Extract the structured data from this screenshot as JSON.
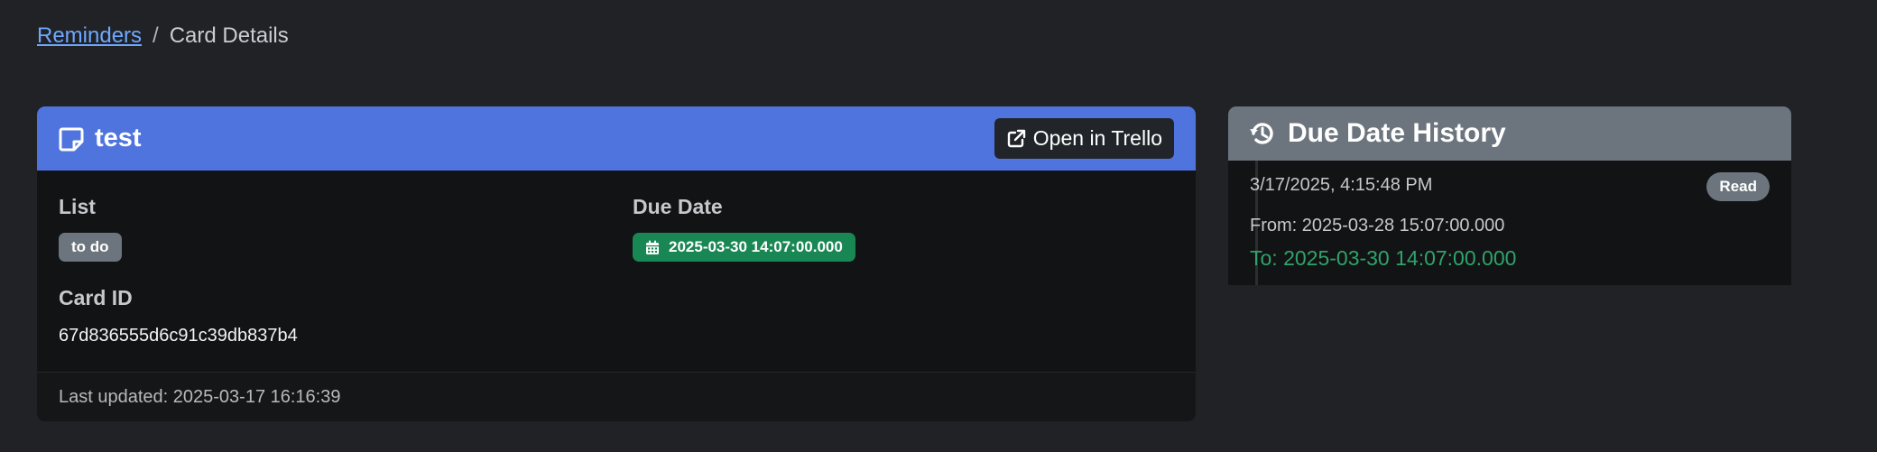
{
  "breadcrumb": {
    "link": "Reminders",
    "separator": "/",
    "current": "Card Details"
  },
  "card": {
    "title": "test",
    "open_button_label": "Open in Trello",
    "list_label": "List",
    "list_value": "to do",
    "due_label": "Due Date",
    "due_value": "2025-03-30 14:07:00.000",
    "card_id_label": "Card ID",
    "card_id_value": "67d836555d6c91c39db837b4",
    "footer": "Last updated: 2025-03-17 16:16:39"
  },
  "history": {
    "title": "Due Date History",
    "entries": [
      {
        "timestamp": "3/17/2025, 4:15:48 PM",
        "status": "Read",
        "from": "From: 2025-03-28 15:07:00.000",
        "to": "To: 2025-03-30 14:07:00.000"
      }
    ]
  },
  "colors": {
    "page_bg": "#212226",
    "card_header_primary": "#5074de",
    "card_header_secondary": "#6c757d",
    "success": "#198754",
    "link": "#6ea8fe"
  },
  "icons": {
    "card_title_icon": "sticky-note-icon",
    "open_button_icon": "external-link-icon",
    "due_badge_icon": "calendar-icon",
    "history_title_icon": "history-icon"
  }
}
